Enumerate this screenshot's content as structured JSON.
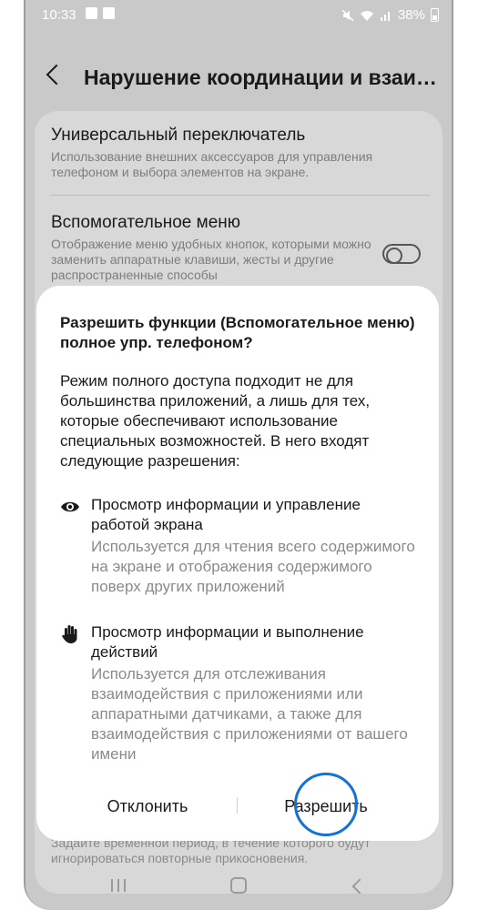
{
  "status_bar": {
    "time": "10:33",
    "battery": "38%",
    "left_icons": [
      "notification-icon",
      "check-icon"
    ],
    "right_icons": [
      "mute-icon",
      "wifi-icon",
      "signal-icon",
      "battery-icon"
    ]
  },
  "header": {
    "title": "Нарушение координации и взаим..."
  },
  "settings": [
    {
      "title": "Универсальный переключатель",
      "subtitle": "Использование внешних аксессуаров для управления телефоном и выбора элементов на экране."
    },
    {
      "title": "Вспомогательное меню",
      "subtitle": "Отображение меню удобных кнопок, которыми можно заменить аппаратные клавиши, жесты и другие распространенные способы",
      "toggle": "off"
    }
  ],
  "background_footer": "Задайте временной период, в течение которого будут игнорироваться повторные прикосновения.",
  "dialog": {
    "title": "Разрешить функции (Вспомогательное меню) полное упр. телефоном?",
    "body": "Режим полного доступа подходит не для большинства приложений, а лишь для тех, которые обеспечивают использование специальных возможностей. В него входят следующие разрешения:",
    "permissions": [
      {
        "icon": "eye-icon",
        "title": "Просмотр информации и управление работой экрана",
        "description": "Используется для чтения всего содержимого на экране и отображения содержимого поверх других приложений"
      },
      {
        "icon": "hand-icon",
        "title": "Просмотр информации и выполнение действий",
        "description": "Используется для отслеживания взаимодействия с приложениями или аппаратными датчиками, а также для взаимодействия с приложениями от вашего имени"
      }
    ],
    "deny_label": "Отклонить",
    "allow_label": "Разрешить"
  },
  "colors": {
    "tap_highlight": "#1272d6",
    "dim_background": "#c9c9c9"
  }
}
